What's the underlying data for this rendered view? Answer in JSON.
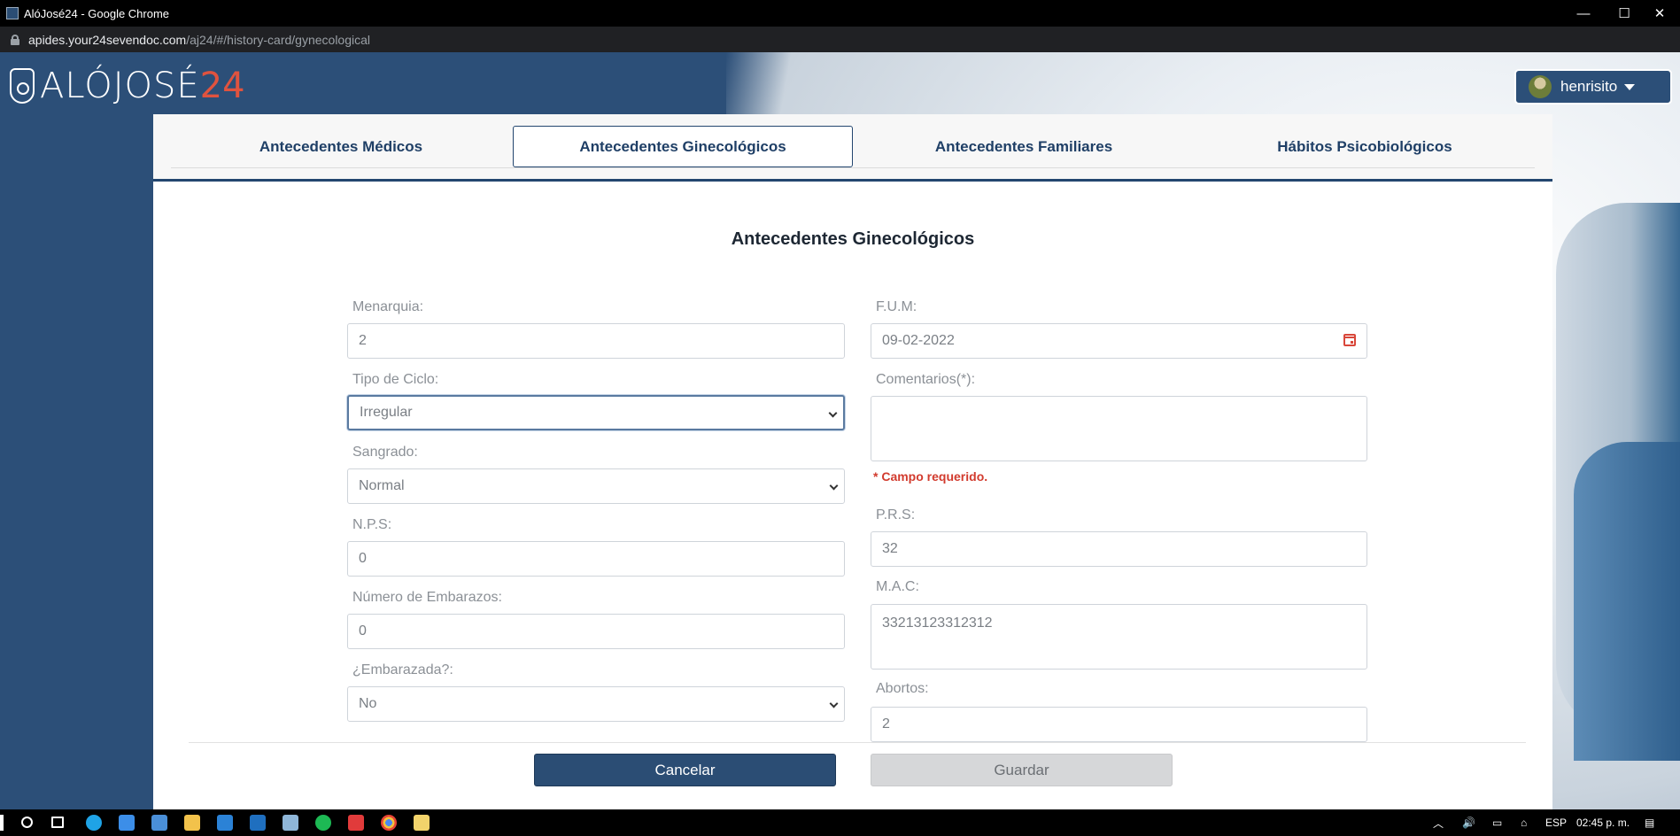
{
  "window": {
    "title": "AlóJosé24 - Google Chrome",
    "controls": [
      "—",
      "☐",
      "✕"
    ]
  },
  "address": {
    "domain": "apides.your24sevendoc.com",
    "path": "/aj24/#/history-card/gynecological"
  },
  "header": {
    "brand": "ALÓJOSÉ",
    "brand_accent": "24",
    "user_name": "henrisito"
  },
  "tabs": [
    {
      "label": "Antecedentes Médicos",
      "active": false
    },
    {
      "label": "Antecedentes Ginecológicos",
      "active": true
    },
    {
      "label": "Antecedentes Familiares",
      "active": false
    },
    {
      "label": "Hábitos Psicobiológicos",
      "active": false
    }
  ],
  "form": {
    "title": "Antecedentes Ginecológicos",
    "menarquia": {
      "label": "Menarquia:",
      "value": "2"
    },
    "tipo_ciclo": {
      "label": "Tipo de Ciclo:",
      "value": "Irregular"
    },
    "sangrado": {
      "label": "Sangrado:",
      "value": "Normal"
    },
    "nps": {
      "label": "N.P.S:",
      "value": "0"
    },
    "num_embarazos": {
      "label": "Número de Embarazos:",
      "value": "0"
    },
    "embarazada": {
      "label": "¿Embarazada?:",
      "value": "No"
    },
    "fum": {
      "label": "F.U.M:",
      "value": "09-02-2022"
    },
    "comentarios": {
      "label": "Comentarios(*):",
      "value": "",
      "error": "* Campo requerido."
    },
    "prs": {
      "label": "P.R.S:",
      "value": "32"
    },
    "mac": {
      "label": "M.A.C:",
      "value": "33213123312312"
    },
    "abortos": {
      "label": "Abortos:",
      "value": "2"
    }
  },
  "actions": {
    "cancel_label": "Cancelar",
    "save_label": "Guardar"
  },
  "tray": {
    "language": "ESP",
    "time": "02:45 p. m."
  },
  "colors": {
    "primary": "#2b4d74",
    "error": "#d23b2e",
    "disabled": "#d6d7d9"
  }
}
